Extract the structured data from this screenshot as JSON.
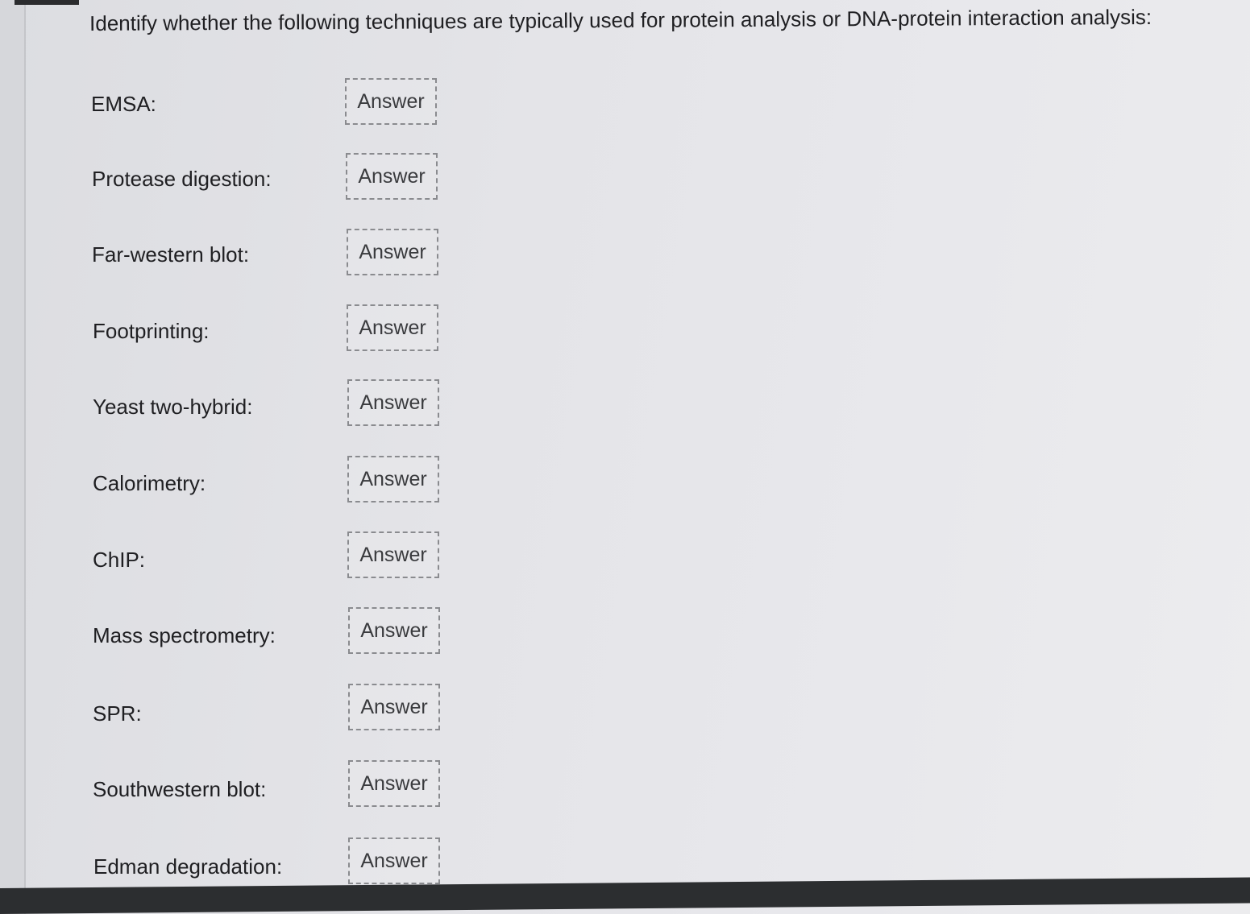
{
  "question": "Identify whether the following techniques are typically used for protein analysis or DNA-protein interaction analysis:",
  "answer_placeholder": "Answer",
  "rows": [
    {
      "label": "EMSA:",
      "answer": "Answer"
    },
    {
      "label": "Protease digestion:",
      "answer": "Answer"
    },
    {
      "label": "Far-western blot:",
      "answer": "Answer"
    },
    {
      "label": "Footprinting:",
      "answer": "Answer"
    },
    {
      "label": "Yeast two-hybrid:",
      "answer": "Answer"
    },
    {
      "label": "Calorimetry:",
      "answer": "Answer"
    },
    {
      "label": "ChIP:",
      "answer": "Answer"
    },
    {
      "label": "Mass spectrometry:",
      "answer": "Answer"
    },
    {
      "label": "SPR:",
      "answer": "Answer"
    },
    {
      "label": "Southwestern blot:",
      "answer": "Answer"
    },
    {
      "label": "Edman degradation:",
      "answer": "Answer"
    }
  ]
}
